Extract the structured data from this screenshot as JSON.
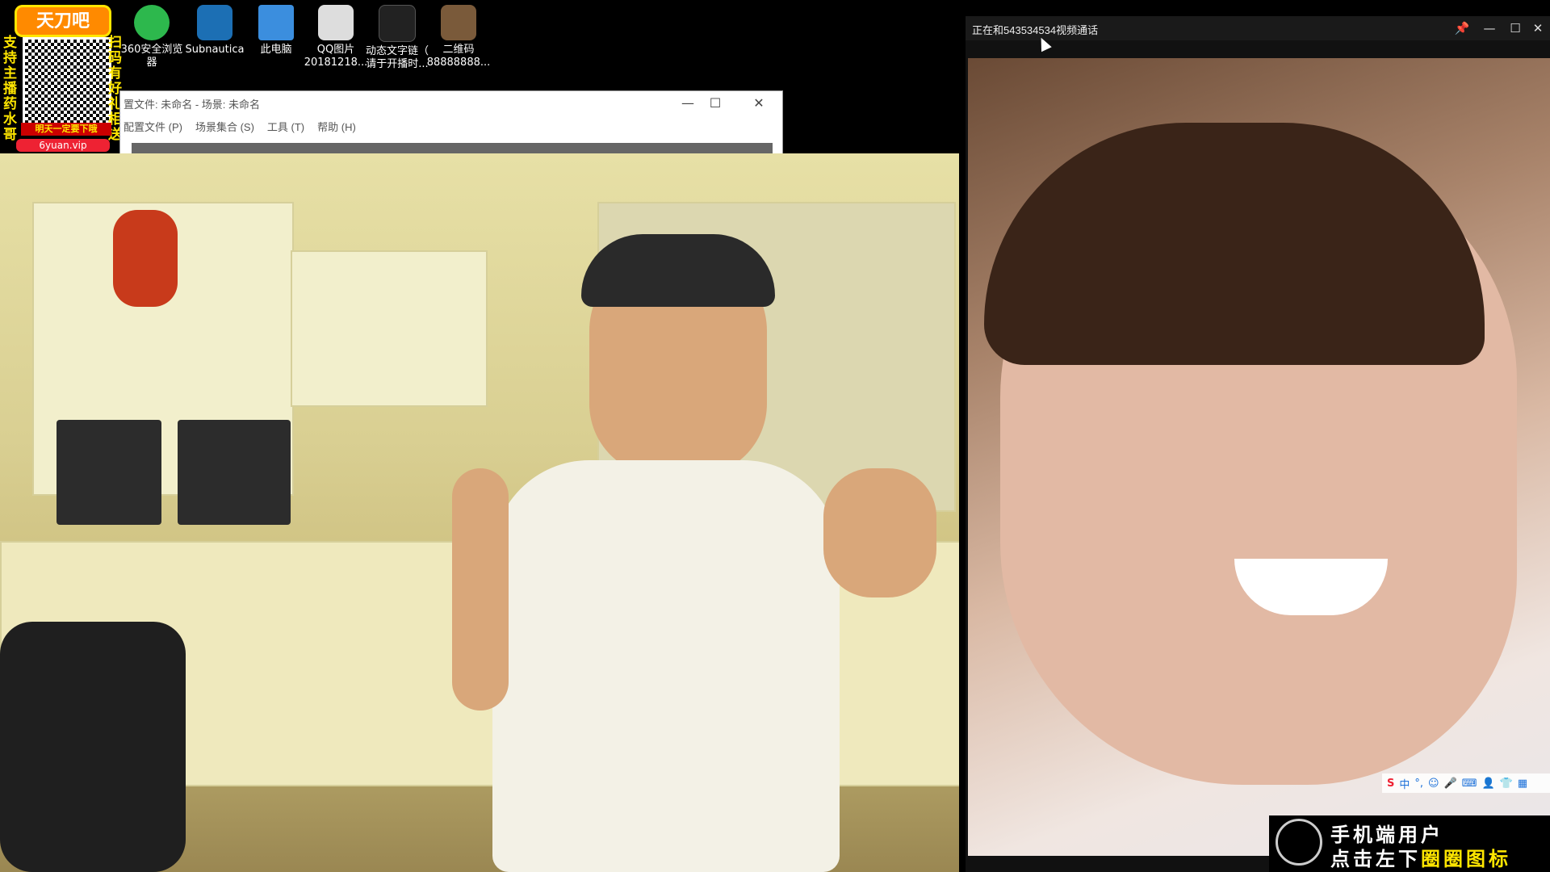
{
  "desktop": {
    "icons": [
      {
        "label": "360安全浏览\n器",
        "icon": "browser-360-icon",
        "color": "#2db84d"
      },
      {
        "label": "Subnautica",
        "icon": "subnautica-icon",
        "color": "#1c6fb4"
      },
      {
        "label": "此电脑",
        "icon": "computer-icon",
        "color": "#3b8ede"
      },
      {
        "label": "QQ图片\n20181218...",
        "icon": "image-file-icon",
        "color": "#dddddd"
      },
      {
        "label": "动态文字链（\n请于开播时...",
        "icon": "text-file-icon",
        "color": "#222222"
      },
      {
        "label": "二维码\n88888888...",
        "icon": "qrcode-file-icon",
        "color": "#7a5a3a"
      }
    ],
    "promo": {
      "banner": "天刀吧",
      "left_text": "支持主播药水哥",
      "right_text": "扫码有好礼相送",
      "bottom_text": "明天一定要下哦",
      "url": "6yuan.vip"
    }
  },
  "obs_window": {
    "title": "置文件: 未命名 - 场景: 未命名",
    "menu": [
      "配置文件 (P)",
      "场景集合 (S)",
      "工具 (T)",
      "帮助 (H)"
    ],
    "controls": {
      "minimize": "—",
      "maximize": "☐",
      "close": "✕"
    }
  },
  "call_window": {
    "title": "正在和543534534视频通话",
    "controls": {
      "pin": "📌",
      "minimize": "—",
      "maximize": "☐",
      "close": "✕"
    }
  },
  "ime_bar": {
    "items": [
      "S",
      "中",
      "°,",
      "☺",
      "🎤",
      "⌨",
      "👤",
      "👕",
      "▦"
    ]
  },
  "mobile_hint": {
    "line1": "手机端用户",
    "line2_a": "点击左下",
    "line2_b": "圈圈图标"
  }
}
